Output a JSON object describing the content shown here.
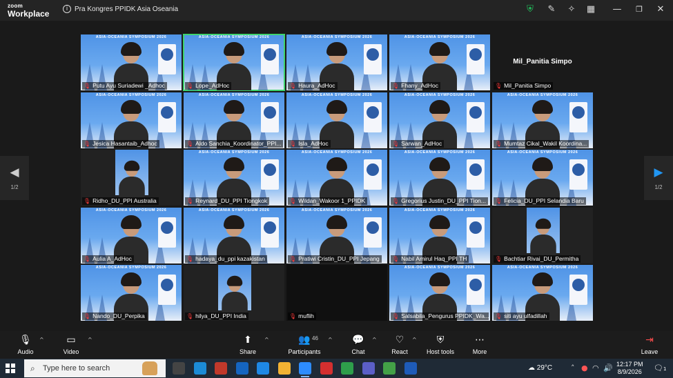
{
  "app": {
    "brand_top": "zoom",
    "brand_bottom": "Workplace",
    "meeting_title": "Pra Kongres PPIDK Asia Oseania",
    "banner": "ASIA-OCEANIA SYMPOSIUM 2026"
  },
  "title_icons": [
    "shield-icon",
    "pen-icon",
    "sparkle-icon",
    "grid-icon"
  ],
  "window_controls": [
    "minimize-icon",
    "maximize-icon",
    "close-icon"
  ],
  "participants": [
    {
      "name": "Putu Ayu Suriadewi _Adhoc",
      "kind": "bg",
      "muted": true
    },
    {
      "name": "Lope_AdHoc",
      "kind": "bg",
      "muted": true,
      "active": true
    },
    {
      "name": "Haura_AdHoc",
      "kind": "bg",
      "muted": true
    },
    {
      "name": "Fhany_AdHoc",
      "kind": "bg",
      "muted": true
    },
    {
      "name": "Mil_Panitia Simpo",
      "kind": "name-only",
      "muted": true,
      "display_name": "Mil_Panitia Simpo"
    },
    {
      "name": "Jesica Hasantaib_Adhoc",
      "kind": "bg",
      "muted": true
    },
    {
      "name": "Aldo Sanchia_Koordinator_PPI...",
      "kind": "bg",
      "muted": true
    },
    {
      "name": "Isla_AdHoc",
      "kind": "bg",
      "muted": true
    },
    {
      "name": "Sarwan_AdHoc",
      "kind": "bg",
      "muted": true
    },
    {
      "name": "Mumtaz Cikal_Wakil Koordina...",
      "kind": "bg",
      "muted": true
    },
    {
      "name": "Ridho_DU_PPI Australia",
      "kind": "small",
      "muted": true
    },
    {
      "name": "Reynard_DU_PPI Tiongkok",
      "kind": "bg",
      "muted": true
    },
    {
      "name": "Wildan_Wakoor 1_PPIDK",
      "kind": "bg",
      "muted": true
    },
    {
      "name": "Gregorius Justin_DU_PPI Tion...",
      "kind": "bg",
      "muted": true
    },
    {
      "name": "Felicia_DU_PPI Selandia Baru",
      "kind": "bg",
      "muted": true
    },
    {
      "name": "Aulia A_AdHoc",
      "kind": "bg",
      "muted": true
    },
    {
      "name": "hadaya_du_ppi kazakistan",
      "kind": "bg",
      "muted": true
    },
    {
      "name": "Pratiwi Cristin_DU_PPI Jepang",
      "kind": "bg",
      "muted": true
    },
    {
      "name": "Nabil Amirul Haq_PPI TH",
      "kind": "bg",
      "muted": true
    },
    {
      "name": "Bachtiar Rivai_DU_Permitha",
      "kind": "small",
      "muted": true
    },
    {
      "name": "Nando_DU_Perpika",
      "kind": "bg",
      "muted": true
    },
    {
      "name": "hilya_DU_PPI India",
      "kind": "small",
      "muted": true
    },
    {
      "name": "muflih",
      "kind": "black",
      "muted": true
    },
    {
      "name": "Salsabila_Pengurus PPIDK_Wa...",
      "kind": "bg",
      "muted": true
    },
    {
      "name": "siti ayu ulfadillah",
      "kind": "bg",
      "muted": true
    }
  ],
  "pager": {
    "left_page": "1/2",
    "right_page": "1/2"
  },
  "toolbar": {
    "audio": "Audio",
    "video": "Video",
    "share": "Share",
    "participants": "Participants",
    "participant_count": "46",
    "chat": "Chat",
    "react": "React",
    "host_tools": "Host tools",
    "more": "More",
    "leave": "Leave"
  },
  "taskbar": {
    "search_placeholder": "Type here to search",
    "apps": [
      "task-view",
      "edge",
      "msn",
      "outlook",
      "dropbox",
      "file-explorer",
      "zoom",
      "opera",
      "chrome",
      "teams",
      "chrome-profile",
      "word"
    ],
    "temperature": "29°C",
    "time": "12:17 PM",
    "date": "8/9/2026",
    "notifications": "1"
  },
  "colors": {
    "accent_active": "#3ed36e",
    "mic_off": "#ff3b3b",
    "pager_arrow": "#2196f3",
    "shield": "#22c55e"
  }
}
